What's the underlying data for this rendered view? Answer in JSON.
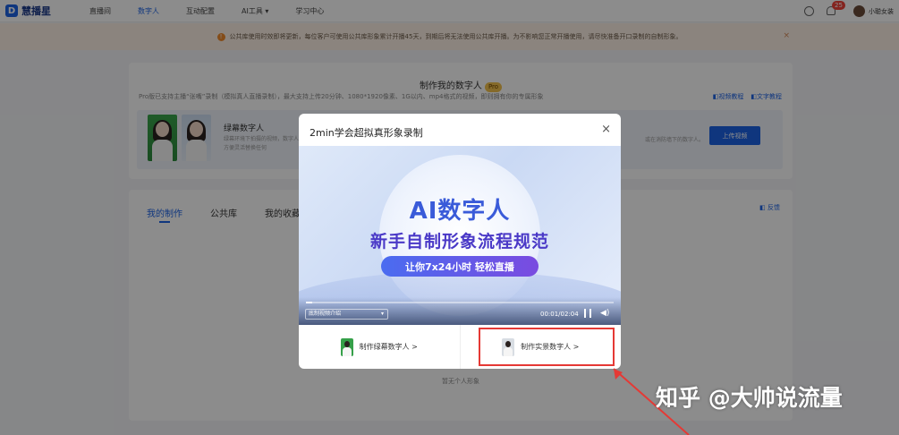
{
  "nav": {
    "logo_text": "慧播星",
    "logo_mark": "D",
    "items": [
      {
        "label": "直播间",
        "active": false
      },
      {
        "label": "数字人",
        "active": true
      },
      {
        "label": "互动配置",
        "active": false
      },
      {
        "label": "AI工具 ▾",
        "active": false
      },
      {
        "label": "学习中心",
        "active": false
      }
    ],
    "notification_count": "25",
    "user_name": "小聪女装"
  },
  "notice": {
    "icon": "!",
    "text": "公共库使用时效即将更新，每位客户可使用公共库形象累计开播45天，到期后将无法使用公共库开播。为不影响您正常开播使用，请尽快准备开口录制的自制形象。",
    "close": "×"
  },
  "create_card": {
    "title": "制作我的数字人",
    "pro_badge": "Pro",
    "description": "Pro版已支持主播“张嘴”录制（模拟真人直播录制），最大支持上传20分钟、1080*1920像素、1G以内、mp4格式的视频，即则拥有你的专属形象",
    "video_tutorial": "◧视频教程",
    "text_tutorial": "◧文字教程",
    "green_title": "绿幕数字人",
    "green_desc": "绿幕环境下拍摄的视频，数字人，方便灵活替换任何",
    "right_desc": "或在消防墙下的数字人。",
    "upload_button": "上传视频"
  },
  "list_card": {
    "tabs": [
      {
        "label": "我的制作",
        "active": true
      },
      {
        "label": "公共库",
        "active": false
      },
      {
        "label": "我的收藏",
        "active": false
      }
    ],
    "feedback": "◧ 反馈",
    "empty_text": "暂无个人形象"
  },
  "modal": {
    "title": "2min学会超拟真形象录制",
    "close": "×",
    "video": {
      "heading": "AI数字人",
      "subheading": "新手自制形象流程规范",
      "pill": "让你7x24小时 轻松直播",
      "chapter": "底制视频介绍",
      "time": "00:01/02:04",
      "progress_fraction": 0.02
    },
    "actions": [
      {
        "label": "制作绿幕数字人 >"
      },
      {
        "label": "制作实景数字人 >"
      }
    ]
  },
  "watermark": "知乎 @大帅说流量",
  "colors": {
    "accent": "#1d63e6",
    "highlight": "#e53935",
    "notice_bg": "#fdf1e6"
  }
}
